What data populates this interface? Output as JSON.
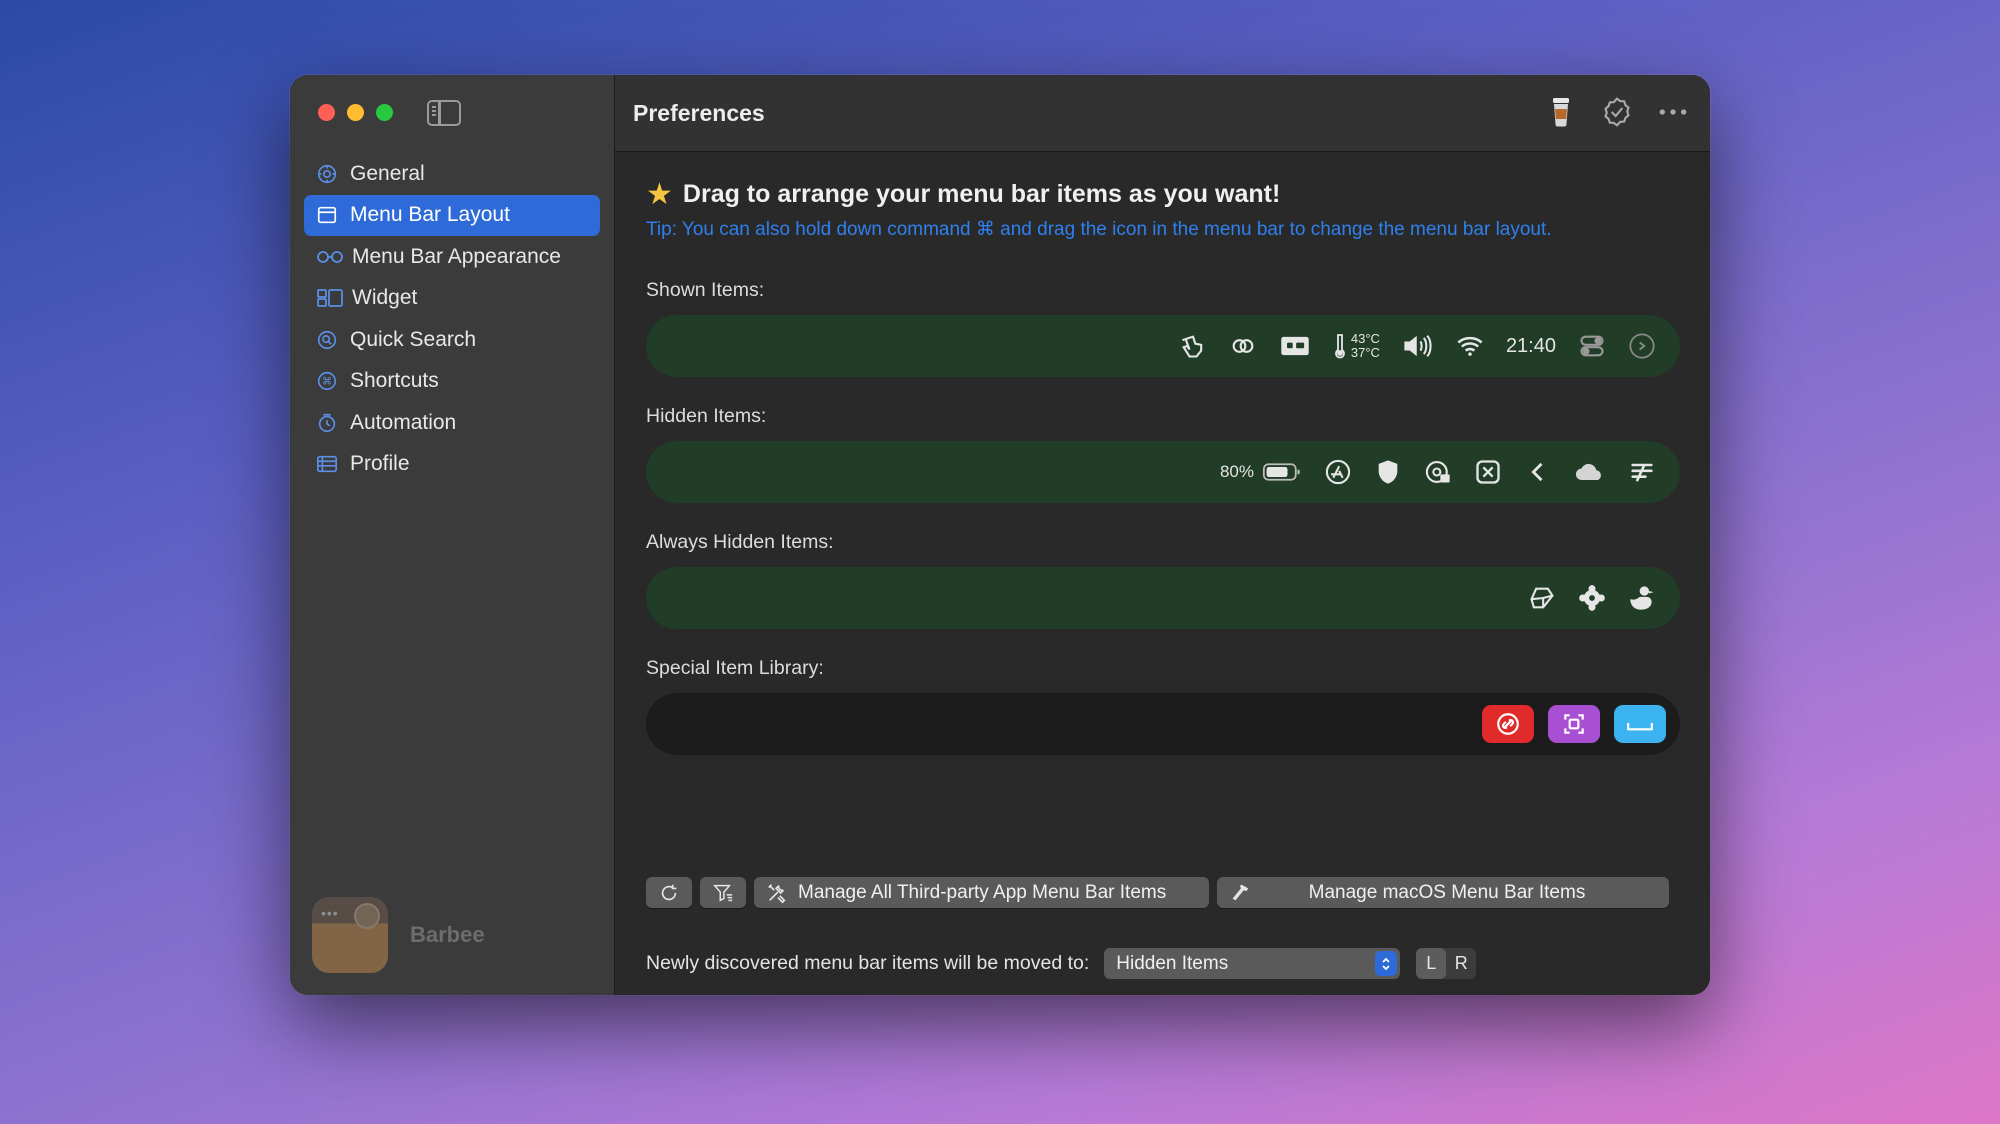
{
  "window": {
    "title": "Preferences"
  },
  "app": {
    "name": "Barbee"
  },
  "sidebar": {
    "items": [
      {
        "label": "General",
        "icon": "gear-icon"
      },
      {
        "label": "Menu Bar Layout",
        "icon": "window-icon",
        "active": true
      },
      {
        "label": "Menu Bar Appearance",
        "icon": "glasses-icon"
      },
      {
        "label": "Widget",
        "icon": "widget-icon"
      },
      {
        "label": "Quick Search",
        "icon": "search-icon"
      },
      {
        "label": "Shortcuts",
        "icon": "command-icon"
      },
      {
        "label": "Automation",
        "icon": "clock-icon"
      },
      {
        "label": "Profile",
        "icon": "profile-icon"
      }
    ]
  },
  "toolbar": {
    "actions": [
      "coffee-cup-icon",
      "verified-badge-icon",
      "more-icon"
    ]
  },
  "main": {
    "headline": "Drag to arrange your menu bar items as you want!",
    "tip": "Tip: You can also hold down command ⌘ and drag the icon in the menu bar to change the menu bar layout.",
    "shown": {
      "label": "Shown Items:",
      "clock": "21:40",
      "temp_high": "43°C",
      "temp_low": "37°C"
    },
    "hidden": {
      "label": "Hidden Items:",
      "battery": "80%"
    },
    "always_hidden": {
      "label": "Always Hidden Items:"
    },
    "library": {
      "label": "Special Item Library:"
    },
    "buttons": {
      "third_party": "Manage All Third-party App Menu Bar Items",
      "macos": "Manage macOS Menu Bar Items"
    },
    "move_to": {
      "label": "Newly discovered menu bar items will be moved to:",
      "selected": "Hidden Items",
      "seg_left": "L",
      "seg_right": "R"
    }
  },
  "colors": {
    "accent": "#2e6bd8",
    "tip": "#2f80ed",
    "bar_green": "#213c27",
    "library_red": "#e12b2b",
    "library_purple": "#a94fd3",
    "library_blue": "#3ab3f0"
  }
}
